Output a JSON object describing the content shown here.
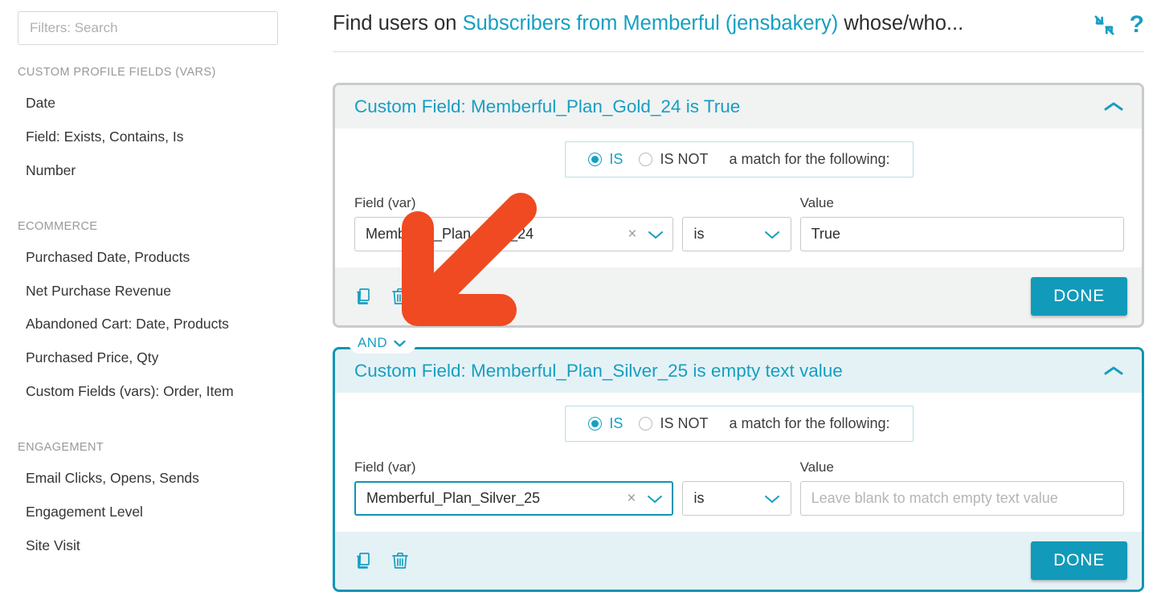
{
  "search": {
    "placeholder": "Filters: Search",
    "value": ""
  },
  "sidebar": {
    "groups": [
      {
        "title": "CUSTOM PROFILE FIELDS (VARS)",
        "items": [
          "Date",
          "Field: Exists, Contains, Is",
          "Number"
        ]
      },
      {
        "title": "ECOMMERCE",
        "items": [
          "Purchased Date, Products",
          "Net Purchase Revenue",
          "Abandoned Cart: Date, Products",
          "Purchased Price, Qty",
          "Custom Fields (vars): Order, Item"
        ]
      },
      {
        "title": "ENGAGEMENT",
        "items": [
          "Email Clicks, Opens, Sends",
          "Engagement Level",
          "Site Visit"
        ]
      }
    ]
  },
  "header": {
    "title_prefix": "Find users on ",
    "title_accent": "Subscribers from Memberful (jensbakery)",
    "title_suffix": " whose/who...",
    "collapse_icon": "collapse-arrows-icon",
    "help_icon": "?"
  },
  "colors": {
    "accent": "#169fc1",
    "button": "#119ab9",
    "active_border": "#0f95b4",
    "inactive_border": "#c9cbcc",
    "active_header_bg": "#e4f2f6",
    "inactive_header_bg": "#f1f2f2",
    "annotation": "#ef4a22"
  },
  "connector": {
    "label": "AND",
    "icon": "chevron-down-icon"
  },
  "labels": {
    "field_var": "Field (var)",
    "value": "Value",
    "is": "IS",
    "is_not": "IS NOT",
    "match_text": "a match for the following:",
    "done": "DONE",
    "collapse_icon": "chevron-up-icon",
    "copy_icon": "copy-icon",
    "delete_icon": "trash-icon",
    "clear_icon": "×",
    "dropdown_icon": "chevron-down-icon"
  },
  "cards": [
    {
      "title": "Custom Field: Memberful_Plan_Gold_24 is True",
      "state": "inactive",
      "match_mode": "IS",
      "field_value": "Memberful_Plan_Gold_24",
      "operator": "is",
      "value": "True",
      "value_placeholder": "",
      "done": "DONE"
    },
    {
      "title": "Custom Field: Memberful_Plan_Silver_25 is empty text value",
      "state": "active",
      "match_mode": "IS",
      "field_value": "Memberful_Plan_Silver_25",
      "operator": "is",
      "value": "",
      "value_placeholder": "Leave blank to match empty text value",
      "done": "DONE"
    }
  ],
  "annotation": {
    "type": "arrow",
    "direction": "down-left",
    "color": "#ef4a22"
  }
}
